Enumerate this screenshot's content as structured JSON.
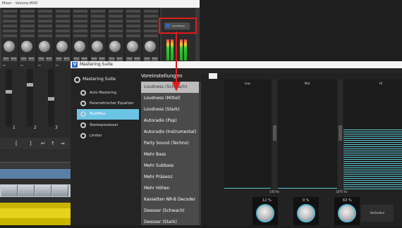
{
  "mixer_window": {
    "title": "Mixer - Volume.MXD",
    "strip_labels": [
      "FX",
      "FX",
      "FX",
      "FX",
      "FX",
      "FX",
      "FX",
      "FX",
      "FX"
    ],
    "solo_label": "SOLO",
    "mute_label": "MUTE",
    "master_button": "MASTERING",
    "highlight_color": "#e01b1b"
  },
  "daw": {
    "channel_numbers": [
      "1",
      "2",
      "3"
    ],
    "toolbar_symbols": [
      "[",
      "]",
      "↩",
      "↑",
      "⇒"
    ]
  },
  "mastering_suite": {
    "title": "Mastering Suite",
    "header": "Mastering Suite",
    "sidebar": [
      {
        "label": "Auto Mastering",
        "active": false
      },
      {
        "label": "Parametrischer Equalizer",
        "active": false
      },
      {
        "label": "MultiMax",
        "active": true
      },
      {
        "label": "Stereoprozessor",
        "active": false
      },
      {
        "label": "Limiter",
        "active": false
      }
    ],
    "presets": {
      "header": "Voreinstellungen",
      "items": [
        "Loudness (Schwach)",
        "Loudness (Mittel)",
        "Loudness (Stark)",
        "Autoradio (Pop)",
        "Autoradio (Instrumental)",
        "Party Sound (Techno)",
        "Mehr Bass",
        "Mehr Subbass",
        "Mehr Präsenz",
        "Mehr Höhen",
        "Kassetten NR-B Decoder",
        "Deesser (Schwach)",
        "Deesser (Stark)"
      ],
      "selected_index": 0
    },
    "bands": [
      {
        "label": "Low",
        "level": 0.02
      },
      {
        "label": "Mid",
        "level": 0.02
      },
      {
        "label": "Hi",
        "level": 0.55
      }
    ],
    "crossovers": [
      "100 Hz",
      "1875 Hz"
    ],
    "knob_values": [
      "12 %",
      "0 %",
      "63 %"
    ],
    "reset_button": "Verändern",
    "accent_color": "#6cc4e4"
  }
}
